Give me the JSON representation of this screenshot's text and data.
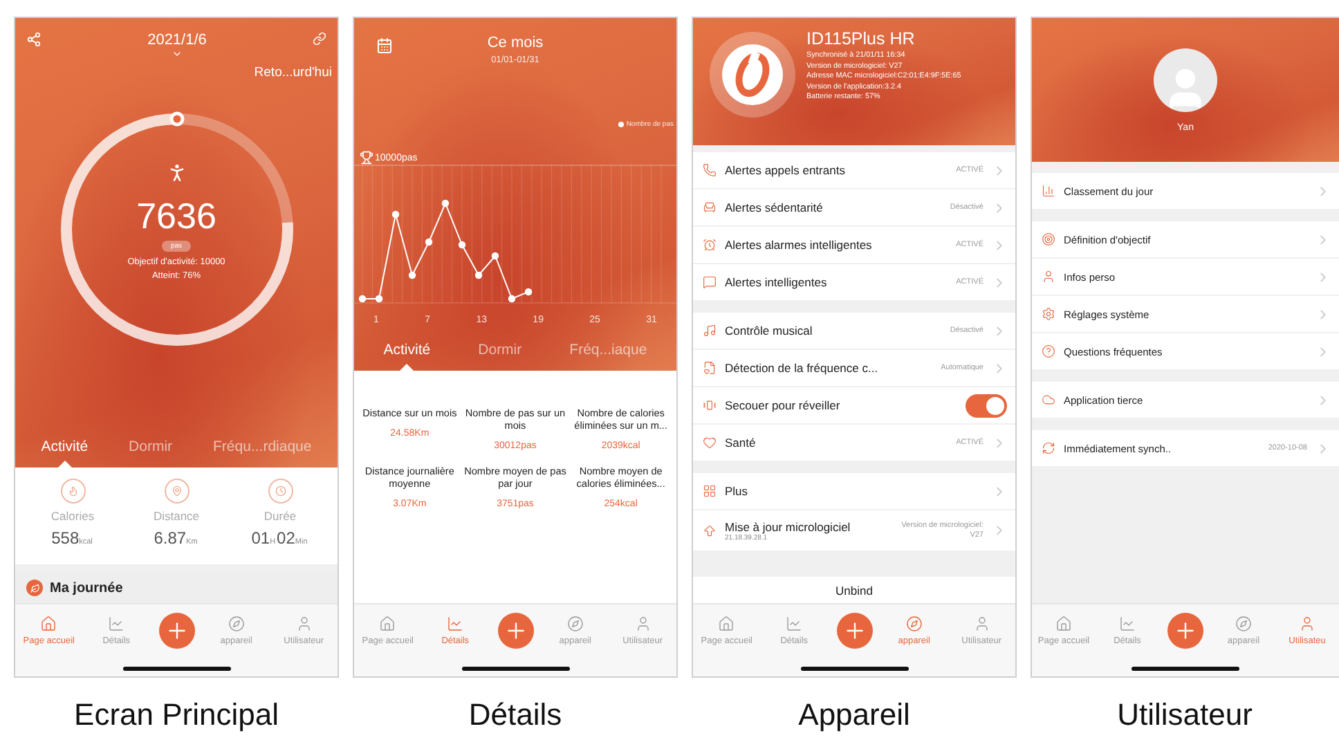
{
  "screens": [
    {
      "kind": "home",
      "caption": "Ecran Principal",
      "date": "2021/1/6",
      "back_link": "Reto...urd'hui",
      "steps": "7636",
      "unit": "pas",
      "goal": "Objectif d'activité: 10000",
      "achieved": "Atteint: 76%",
      "level": 0.76,
      "tabs": [
        {
          "label": "Activité",
          "selected": true
        },
        {
          "label": "Dormir",
          "selected": false
        },
        {
          "label": "Fréqu...rdiaque",
          "selected": false
        }
      ],
      "stats": [
        {
          "label": "Calories",
          "parts": [
            {
              "value": "558",
              "unit": "kcal"
            }
          ]
        },
        {
          "label": "Distance",
          "parts": [
            {
              "value": "6.87",
              "unit": "Km"
            }
          ]
        },
        {
          "label": "Durée",
          "parts": [
            {
              "value": "01",
              "unit": "H"
            },
            {
              "value": "02",
              "unit": "Min"
            }
          ]
        }
      ],
      "section": "Ma journée",
      "nav": [
        {
          "label": "Page accueil",
          "selected": true
        },
        {
          "label": "Détails",
          "selected": false
        },
        {
          "label": "appareil",
          "selected": false
        },
        {
          "label": "Utilisateur",
          "selected": false
        }
      ]
    },
    {
      "kind": "details",
      "caption": "Détails",
      "title": "Ce mois",
      "range": "01/01-01/31",
      "legend": "Nombre de pas",
      "goal": "10000pas",
      "x_ticks": [
        "1",
        "7",
        "13",
        "19",
        "25",
        "31"
      ],
      "tabs": [
        {
          "label": "Activité",
          "selected": true
        },
        {
          "label": "Dormir",
          "selected": false
        },
        {
          "label": "Fréq...iaque",
          "selected": false
        }
      ],
      "stats": [
        {
          "label": "Distance sur un mois",
          "value": "24.58Km"
        },
        {
          "label": "Nombre de pas sur un mois",
          "value": "30012pas"
        },
        {
          "label": "Nombre de calories éliminées sur un m...",
          "value": "2039kcal"
        },
        {
          "label": "Distance journalière moyenne",
          "value": "3.07Km"
        },
        {
          "label": "Nombre moyen de pas par jour",
          "value": "3751pas"
        },
        {
          "label": "Nombre moyen de calories éliminées...",
          "value": "254kcal"
        }
      ],
      "nav": [
        {
          "label": "Page accueil",
          "selected": false
        },
        {
          "label": "Détails",
          "selected": true
        },
        {
          "label": "appareil",
          "selected": false
        },
        {
          "label": "Utilisateur",
          "selected": false
        }
      ]
    },
    {
      "kind": "device",
      "caption": "Appareil",
      "name": "ID115Plus HR",
      "info": [
        "Synchronisé à 21/01/11 16:34",
        "Version de micrologiciel: V27",
        "Adresse MAC micrologiciel:C2:01:E4:9F:5E:65",
        "Version de l'application:3.2.4",
        "Batterie restante: 57%"
      ],
      "groups": [
        [
          {
            "kind": "status",
            "label": "Alertes appels entrants",
            "value": "ACTIVÉ"
          },
          {
            "kind": "status",
            "label": "Alertes sédentarité",
            "value": "Désactivé"
          },
          {
            "kind": "status",
            "label": "Alertes alarmes intelligentes",
            "value": "ACTIVÉ"
          },
          {
            "kind": "status",
            "label": "Alertes intelligentes",
            "value": "ACTIVÉ"
          }
        ],
        [
          {
            "kind": "status",
            "label": "Contrôle musical",
            "value": "Désactivé"
          },
          {
            "kind": "status",
            "label": "Détection de la fréquence c...",
            "value": "Automatique"
          },
          {
            "kind": "toggle",
            "label": "Secouer pour réveiller",
            "on": true
          },
          {
            "kind": "status",
            "label": "Santé",
            "value": "ACTIVÉ"
          }
        ],
        [
          {
            "kind": "status",
            "label": "Plus"
          },
          {
            "kind": "status",
            "label": "Mise à jour micrologiciel",
            "sub": "21.18.39.28.1",
            "value": "Version de micrologiciel: V27"
          }
        ]
      ],
      "unbind": "Unbind",
      "nav": [
        {
          "label": "Page accueil",
          "selected": false
        },
        {
          "label": "Détails",
          "selected": false
        },
        {
          "label": "appareil",
          "selected": true
        },
        {
          "label": "Utilisateur",
          "selected": false
        }
      ]
    },
    {
      "kind": "user",
      "caption": "Utilisateur",
      "username": "Yan",
      "groups": [
        [
          {
            "kind": "status",
            "label": "Classement du jour"
          }
        ],
        [
          {
            "kind": "status",
            "label": "Définition d'objectif"
          },
          {
            "kind": "status",
            "label": "Infos perso"
          },
          {
            "kind": "status",
            "label": "Réglages système"
          },
          {
            "kind": "status",
            "label": "Questions fréquentes"
          }
        ],
        [
          {
            "kind": "status",
            "label": "Application tierce"
          }
        ],
        [
          {
            "kind": "status",
            "label": "Immédiatement synch..",
            "value": "2020-10-08"
          }
        ]
      ],
      "nav": [
        {
          "label": "Page accueil",
          "selected": false
        },
        {
          "label": "Détails",
          "selected": false
        },
        {
          "label": "appareil",
          "selected": false
        },
        {
          "label": "Utilisateu",
          "selected": true
        }
      ]
    }
  ]
}
